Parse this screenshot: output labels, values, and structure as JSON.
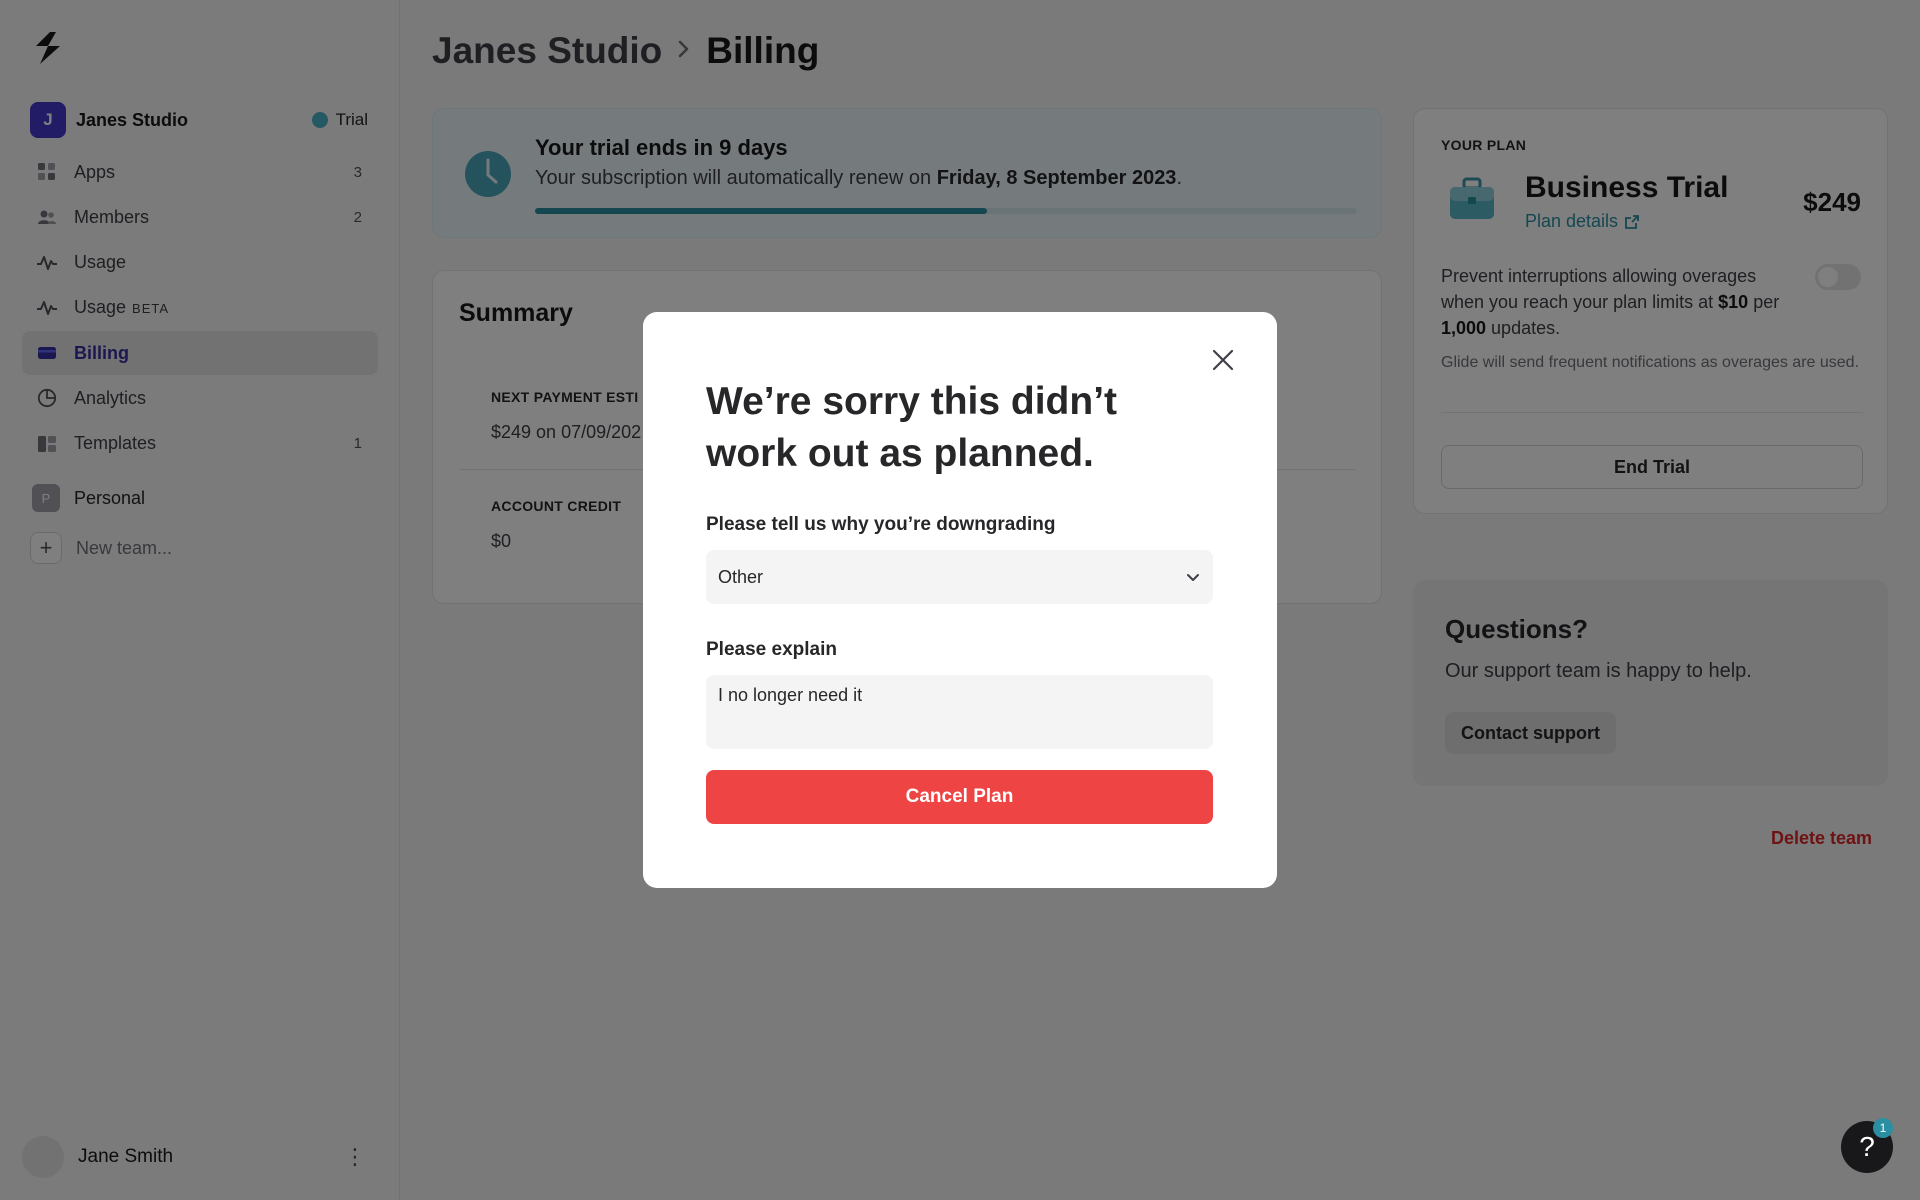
{
  "sidebar": {
    "team": {
      "initial": "J",
      "name": "Janes Studio",
      "badge": "Trial"
    },
    "items": [
      {
        "label": "Apps",
        "count": "3",
        "icon": "apps-icon"
      },
      {
        "label": "Members",
        "count": "2",
        "icon": "members-icon"
      },
      {
        "label": "Usage",
        "count": "",
        "icon": "usage-icon"
      },
      {
        "label": "Usage",
        "beta": "BETA",
        "count": "",
        "icon": "usage-beta-icon"
      },
      {
        "label": "Billing",
        "count": "",
        "icon": "billing-icon",
        "active": true
      },
      {
        "label": "Analytics",
        "count": "",
        "icon": "analytics-icon"
      },
      {
        "label": "Templates",
        "count": "1",
        "icon": "templates-icon"
      }
    ],
    "personal": {
      "initial": "P",
      "label": "Personal"
    },
    "new_team": "New team...",
    "user": {
      "name": "Jane Smith"
    }
  },
  "breadcrumb": {
    "team": "Janes Studio",
    "page": "Billing"
  },
  "trial": {
    "title": "Your trial ends in 9 days",
    "text_prefix": "Your subscription will automatically renew on ",
    "renew_date": "Friday, 8 September 2023",
    "text_suffix": ".",
    "progress": 0.55
  },
  "summary": {
    "title": "Summary",
    "next_payment_label": "NEXT PAYMENT ESTI",
    "next_payment_value": "$249 on 07/09/202",
    "credit_label": "ACCOUNT CREDIT",
    "credit_value": "$0"
  },
  "plan": {
    "eyebrow": "YOUR PLAN",
    "name": "Business Trial",
    "details_link": "Plan details",
    "price": "$249",
    "overage_1": "Prevent interruptions allowing overages when you reach your plan limits at ",
    "overage_amount": "$10",
    "overage_2": " per ",
    "overage_units": "1,000",
    "overage_3": " updates.",
    "note": "Glide will send frequent notifications as overages are used.",
    "end_trial": "End Trial"
  },
  "questions": {
    "title": "Questions?",
    "text": "Our support team is happy to help.",
    "button": "Contact support"
  },
  "delete_team": "Delete team",
  "help": {
    "glyph": "?",
    "badge": "1"
  },
  "modal": {
    "title": "We’re sorry this didn’t work out as planned.",
    "reason_label": "Please tell us why you’re downgrading",
    "reason_value": "Other",
    "explain_label": "Please explain",
    "explain_value": "I no longer need it",
    "submit": "Cancel Plan"
  },
  "colors": {
    "accent": "#2b8fa3",
    "brand": "#4338ca",
    "danger": "#ef4444"
  }
}
